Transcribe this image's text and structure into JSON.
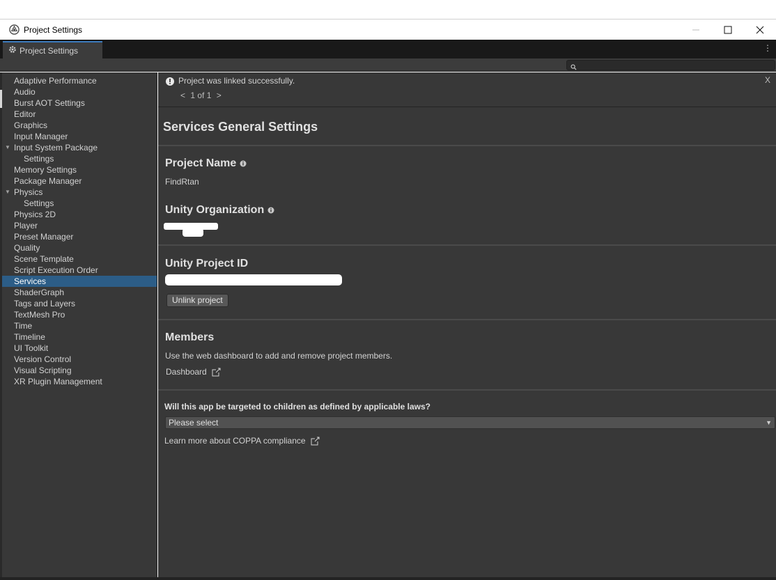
{
  "window": {
    "title": "Project Settings",
    "minimize_label": "—",
    "maximize_label": "☐",
    "close_label": "✕"
  },
  "tab": {
    "label": "Project Settings",
    "menu_glyph": "⋮"
  },
  "search": {
    "placeholder": "",
    "value": ""
  },
  "sidebar": {
    "items": [
      {
        "label": "Adaptive Performance"
      },
      {
        "label": "Audio"
      },
      {
        "label": "Burst AOT Settings"
      },
      {
        "label": "Editor"
      },
      {
        "label": "Graphics"
      },
      {
        "label": "Input Manager"
      },
      {
        "label": "Input System Package"
      },
      {
        "label": "Settings"
      },
      {
        "label": "Memory Settings"
      },
      {
        "label": "Package Manager"
      },
      {
        "label": "Physics"
      },
      {
        "label": "Settings"
      },
      {
        "label": "Physics 2D"
      },
      {
        "label": "Player"
      },
      {
        "label": "Preset Manager"
      },
      {
        "label": "Quality"
      },
      {
        "label": "Scene Template"
      },
      {
        "label": "Script Execution Order"
      },
      {
        "label": "Services"
      },
      {
        "label": "ShaderGraph"
      },
      {
        "label": "Tags and Layers"
      },
      {
        "label": "TextMesh Pro"
      },
      {
        "label": "Time"
      },
      {
        "label": "Timeline"
      },
      {
        "label": "UI Toolkit"
      },
      {
        "label": "Version Control"
      },
      {
        "label": "Visual Scripting"
      },
      {
        "label": "XR Plugin Management"
      }
    ],
    "selected": "Services"
  },
  "notification": {
    "message": "Project was linked successfully.",
    "prev": "<",
    "page": "1 of 1",
    "next": ">",
    "close": "X"
  },
  "main": {
    "title": "Services General Settings",
    "project_name_label": "Project Name",
    "project_name_value": "FindRtan",
    "organization_label": "Unity Organization",
    "project_id_label": "Unity Project ID",
    "unlink_button": "Unlink project",
    "members_title": "Members",
    "members_desc": "Use the web dashboard to add and remove project members.",
    "dashboard_link": "Dashboard",
    "children_question": "Will this app be targeted to children as defined by applicable laws?",
    "children_select": "Please select",
    "coppa_link": "Learn more about COPPA compliance"
  },
  "colors": {
    "panel_bg": "#383838",
    "selection": "#2c5d87",
    "tab_accent": "#3a79bb"
  }
}
